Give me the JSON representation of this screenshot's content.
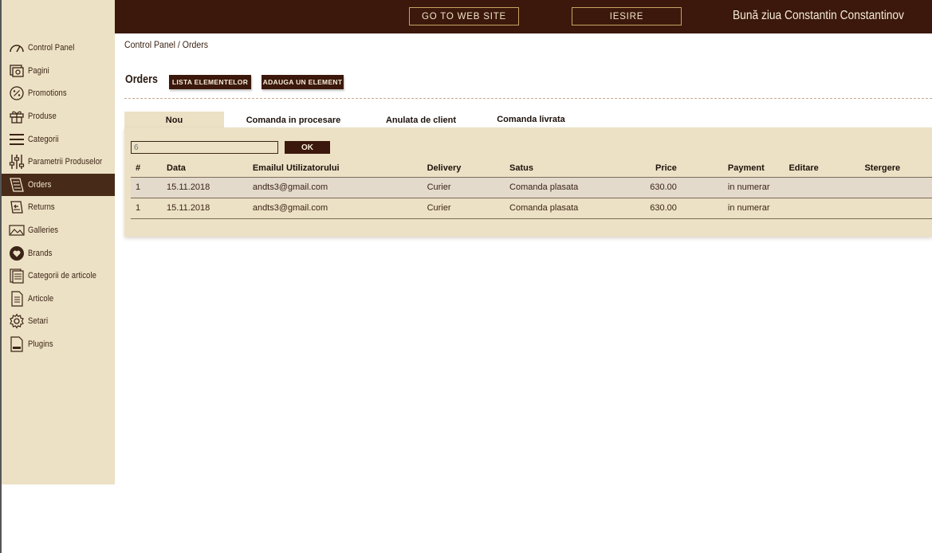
{
  "header": {
    "go_to_website": "GO TO WEB SITE",
    "logout": "IESIRE",
    "greeting": "Bună ziua Constantin Constantinov"
  },
  "sidebar": {
    "items": [
      {
        "label": "Control Panel",
        "icon": "dashboard-icon"
      },
      {
        "label": "Pagini",
        "icon": "pages-icon"
      },
      {
        "label": "Promotions",
        "icon": "percent-icon"
      },
      {
        "label": "Produse",
        "icon": "gift-icon"
      },
      {
        "label": "Categorii",
        "icon": "menu-icon"
      },
      {
        "label": "Parametrii Produselor",
        "icon": "sliders-icon"
      },
      {
        "label": "Orders",
        "icon": "orders-icon",
        "active": true
      },
      {
        "label": "Returns",
        "icon": "returns-icon"
      },
      {
        "label": "Galleries",
        "icon": "gallery-icon"
      },
      {
        "label": "Brands",
        "icon": "brand-heart-icon"
      },
      {
        "label": "Categorii de articole",
        "icon": "article-categories-icon"
      },
      {
        "label": "Articole",
        "icon": "article-icon"
      },
      {
        "label": "Setari",
        "icon": "gear-icon"
      },
      {
        "label": "Plugins",
        "icon": "plugin-file-icon"
      }
    ]
  },
  "breadcrumb": "Control Panel / Orders",
  "page": {
    "title": "Orders",
    "list_button": "LISTA ELEMENTELOR",
    "add_button": "ADAUGA UN ELEMENT"
  },
  "tabs": [
    "Nou",
    "Comanda in procesare",
    "Anulata de client",
    "Comanda livrata"
  ],
  "filter": {
    "placeholder": "6",
    "ok": "OK"
  },
  "table": {
    "headers": [
      "#",
      "Data",
      "Emailul Utilizatorului",
      "Delivery",
      "Satus",
      "Price",
      "Payment",
      "Editare",
      "Stergere"
    ],
    "rows": [
      {
        "num": "1",
        "date": "15.11.2018",
        "email": "andts3@gmail.com",
        "delivery": "Curier",
        "status": "Comanda plasata",
        "price": "630.00",
        "payment": "in numerar"
      },
      {
        "num": "1",
        "date": "15.11.2018",
        "email": "andts3@gmail.com",
        "delivery": "Curier",
        "status": "Comanda plasata",
        "price": "630.00",
        "payment": "in numerar"
      }
    ]
  },
  "colors": {
    "header_bg": "#3b180b",
    "sidebar_bg": "#ece1c5",
    "active_bg": "#472a18",
    "accent_border": "#c8a265"
  }
}
